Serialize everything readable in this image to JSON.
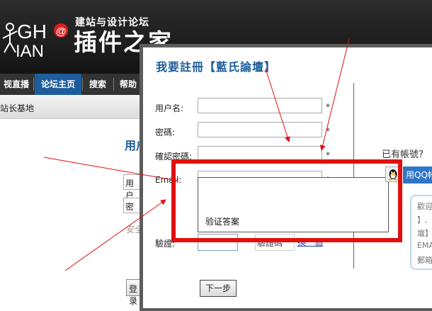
{
  "site": {
    "logo_letters_top": "GH",
    "logo_at": "@",
    "logo_letters_bottom": "IAN",
    "tagline": "建站与设计论坛",
    "name": "插件之家"
  },
  "nav": {
    "items": [
      {
        "label": "视直播"
      },
      {
        "label": "论坛主页"
      },
      {
        "label": "搜索"
      },
      {
        "label": "帮助"
      }
    ]
  },
  "breadcrumb": "站长基地",
  "background_form": {
    "heading": "用户",
    "username_prefix": "用户",
    "password_prefix": "密",
    "safety_prefix": "安全",
    "login_prefix": "登录"
  },
  "dialog": {
    "title": "我要註冊【藍氏論壇】",
    "fields": {
      "username_label": "用户名:",
      "password_label": "密碼:",
      "confirm_label": "確認密碼:",
      "email_label": "Email:",
      "required_mark": "*"
    },
    "dropdown_option": "验证答案",
    "captcha": {
      "label": "驗證:",
      "image_text": "驗證碼",
      "refresh_link": "換一個"
    },
    "next_button": "下一步",
    "has_account": "已有帳號?",
    "qq_login": "用QQ帐号登录",
    "info_lines": [
      "歡迎",
      "】,",
      "壇】",
      "EMA",
      "郵箱"
    ]
  },
  "colors": {
    "brand_blue": "#1d5d9b",
    "annotation_red": "#e01010",
    "dialog_border": "#5c5c5c",
    "header_bg": "#1e1e1e"
  }
}
